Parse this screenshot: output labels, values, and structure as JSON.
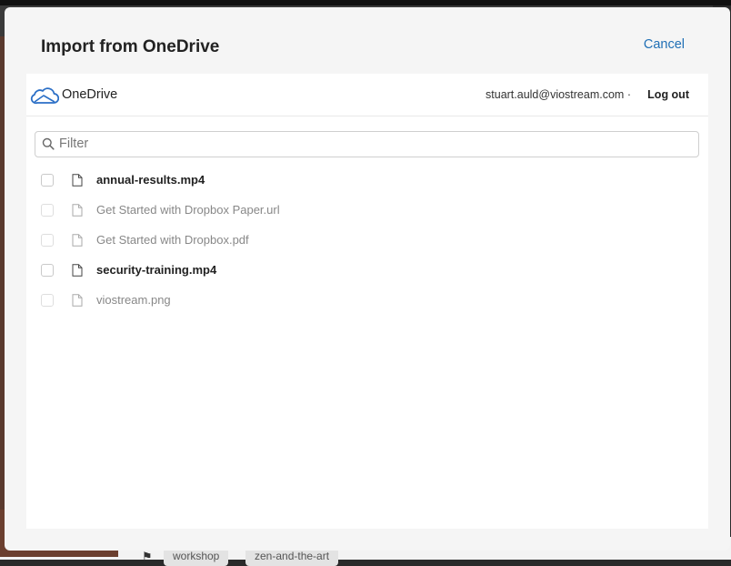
{
  "backdrop": {
    "tags": [
      "workshop",
      "zen-and-the-art"
    ]
  },
  "dialog": {
    "title": "Import from OneDrive",
    "cancel_label": "Cancel"
  },
  "provider": {
    "name": "OneDrive",
    "logo_icon": "onedrive-cloud-icon",
    "account_email": "stuart.auld@viostream.com",
    "separator": "·",
    "logout_label": "Log out"
  },
  "filter": {
    "placeholder": "Filter",
    "value": ""
  },
  "files": [
    {
      "name": "annual-results.mp4",
      "enabled": true,
      "checked": false
    },
    {
      "name": "Get Started with Dropbox Paper.url",
      "enabled": false,
      "checked": false
    },
    {
      "name": "Get Started with Dropbox.pdf",
      "enabled": false,
      "checked": false
    },
    {
      "name": "security-training.mp4",
      "enabled": true,
      "checked": false
    },
    {
      "name": "viostream.png",
      "enabled": false,
      "checked": false
    }
  ],
  "colors": {
    "accent": "#1f6fb5",
    "onedrive_blue": "#2b6fc6"
  }
}
